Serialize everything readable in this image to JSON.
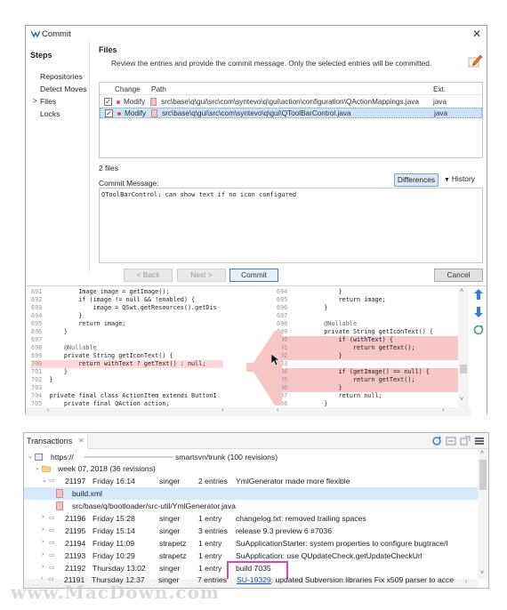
{
  "dialog": {
    "title": "Commit",
    "steps_title": "Steps",
    "steps": [
      "Repositories",
      "Detect Moves",
      "Files",
      "Locks"
    ],
    "current_step_arrow": ">",
    "files_header": "Files",
    "files_description": "Review the entries and provide the commit message. Only the selected entries will be committed.",
    "table_headers": {
      "change": "Change",
      "path": "Path",
      "ext": "Ext."
    },
    "files": [
      {
        "checked": "✓",
        "change": "Modify",
        "path": "src\\base\\q\\gui\\src\\com\\syntevo\\q\\gui\\action\\configuration\\QActionMappings.java",
        "ext": "java"
      },
      {
        "checked": "✓",
        "change": "Modify",
        "path": "src\\base\\q\\gui\\src\\com\\syntevo\\q\\gui\\QToolBarControl.java",
        "ext": "java"
      }
    ],
    "file_count": "2 files",
    "commit_message_label": "Commit Message:",
    "differences_label": "Differences",
    "history_label": "History",
    "commit_message": "QToolBarControl: can show text if no icon configured",
    "buttons": {
      "back": "< Back",
      "next": "Next >",
      "commit": "Commit",
      "cancel": "Cancel"
    }
  },
  "diff_left": {
    "lines": [
      {
        "n": "691",
        "t": "        Image image = getImage();"
      },
      {
        "n": "692",
        "t": "        if (image != null && !enabled) {"
      },
      {
        "n": "693",
        "t": "            image = QSwt.getResources().getDis"
      },
      {
        "n": "694",
        "t": "        }"
      },
      {
        "n": "695",
        "t": "        return image;"
      },
      {
        "n": "696",
        "t": "    }"
      },
      {
        "n": "697",
        "t": ""
      },
      {
        "n": "698",
        "t": "    @Nullable"
      },
      {
        "n": "699",
        "t": "    private String getIconText() {"
      },
      {
        "n": "700",
        "t": "        return withText ? getText() : null;"
      },
      {
        "n": "701",
        "t": "    }"
      },
      {
        "n": "702",
        "t": "}"
      },
      {
        "n": "703",
        "t": ""
      },
      {
        "n": "704",
        "t": "private final class ActionItem extends ButtonI"
      },
      {
        "n": "705",
        "t": "    private final QAction action;"
      }
    ]
  },
  "diff_right": {
    "lines": [
      {
        "n": "694",
        "t": "            }"
      },
      {
        "n": "695",
        "t": "            return image;"
      },
      {
        "n": "696",
        "t": "        }"
      },
      {
        "n": "697",
        "t": ""
      },
      {
        "n": "698",
        "t": "        @Nullable"
      },
      {
        "n": "699",
        "t": "        private String getIconText() {"
      },
      {
        "n": "700",
        "t": "            if (withText) {"
      },
      {
        "n": "701",
        "t": "                return getText();"
      },
      {
        "n": "702",
        "t": "            }"
      },
      {
        "n": "703",
        "t": ""
      },
      {
        "n": "704",
        "t": "            if (getImage() == null) {"
      },
      {
        "n": "705",
        "t": "                return getText();"
      },
      {
        "n": "706",
        "t": "            }"
      },
      {
        "n": "707",
        "t": "            return null;"
      },
      {
        "n": "708",
        "t": "        }"
      }
    ]
  },
  "transactions": {
    "tab_label": "Transactions",
    "root": "https://",
    "root_suffix": "smartsvn/trunk (100 revisions)",
    "week": "week 07, 2018 (36 revisions)",
    "rows": [
      {
        "rev": "21197",
        "date": "Friday 16:14",
        "user": "singer",
        "entries": "2  entries",
        "msg": "YmlGenerator made more flexible"
      },
      {
        "rev": "21196",
        "date": "Friday 15:28",
        "user": "singer",
        "entries": "1  entry",
        "msg": "changelog.txt: removed trailing spaces"
      },
      {
        "rev": "21195",
        "date": "Friday 15:14",
        "user": "singer",
        "entries": "3  entries",
        "msg": "release 9.3 preview 6 #7036"
      },
      {
        "rev": "21194",
        "date": "Friday 11:09",
        "user": "strapetz",
        "entries": "1  entry",
        "msg": "SuApplicationStarter: system properties to configure bugtrace/l"
      },
      {
        "rev": "21193",
        "date": "Friday 10:29",
        "user": "strapetz",
        "entries": "1  entry",
        "msg": "SuApplication: use QUpdateCheck.getUpdateCheckUrl"
      },
      {
        "rev": "21192",
        "date": "Thursday 13:02",
        "user": "singer",
        "entries": "1  entry",
        "msg": "build 7035"
      },
      {
        "rev": "21191",
        "date": "Thursday 12:37",
        "user": "singer",
        "entries": "7  entries",
        "msg": ": updated Subversion libraries  Fix x509 parser to acce"
      }
    ],
    "children": [
      "build.xml",
      "src/base/q/bootloader/src-util/YmlGenerator.java"
    ],
    "link_text": "SU-19329"
  },
  "watermark": "www.MacDown.com",
  "colors": {
    "accent": "#3c7fc4",
    "removed": "#f7c6c6",
    "selection": "#d6e9fb",
    "highlight_box": "#e040c8"
  }
}
